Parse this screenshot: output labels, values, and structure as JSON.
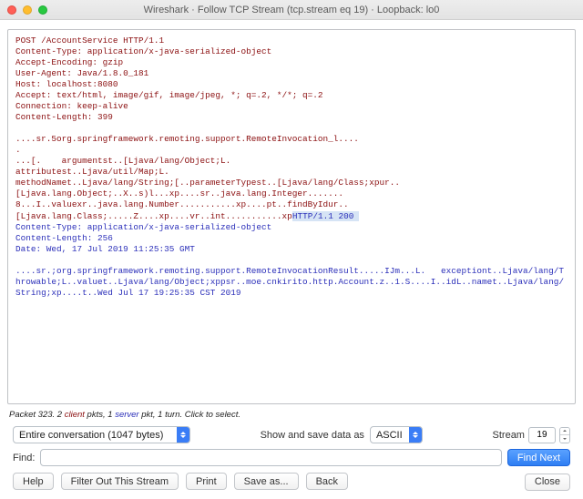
{
  "window": {
    "title": "Wireshark · Follow TCP Stream (tcp.stream eq 19) · Loopback: lo0"
  },
  "stream": {
    "client_block": "POST /AccountService HTTP/1.1\nContent-Type: application/x-java-serialized-object\nAccept-Encoding: gzip\nUser-Agent: Java/1.8.0_181\nHost: localhost:8080\nAccept: text/html, image/gif, image/jpeg, *; q=.2, */*; q=.2\nConnection: keep-alive\nContent-Length: 399\n\n....sr.5org.springframework.remoting.support.RemoteInvocation_l....\n.\n...[.    argumentst..[Ljava/lang/Object;L.\nattributest..Ljava/util/Map;L.\nmethodNamet..Ljava/lang/String;[..parameterTypest..[Ljava/lang/Class;xpur..\n[Ljava.lang.Object;..X..s)l...xp....sr..java.lang.Integer.......\n8...I..valuexr..java.lang.Number...........xp....pt..findByIdur..\n[Ljava.lang.Class;.....Z....xp....vr..int...........xp",
    "server_prefix": "HTTP/1.1 200 ",
    "server_block": "\nContent-Type: application/x-java-serialized-object\nContent-Length: 256\nDate: Wed, 17 Jul 2019 11:25:35 GMT\n\n....sr.;org.springframework.remoting.support.RemoteInvocationResult.....IJm...L.   exceptiont..Ljava/lang/Throwable;L..valuet..Ljava/lang/Object;xppsr..moe.cnkirito.http.Account.z..1.S....I..idL..namet..Ljava/lang/String;xp....t..Wed Jul 17 19:25:35 CST 2019"
  },
  "summary": {
    "p1": "Packet 323. 2 ",
    "client_word": "client",
    "p2": " pkts, 1 ",
    "server_word": "server",
    "p3": " pkt, 1 turn. Click to select."
  },
  "controls": {
    "conversation_label": "Entire conversation (1047 bytes)",
    "show_save_label": "Show and save data as",
    "format_value": "ASCII",
    "stream_label": "Stream",
    "stream_value": "19"
  },
  "findrow": {
    "label": "Find:",
    "placeholder": "",
    "button": "Find Next"
  },
  "buttons": {
    "help": "Help",
    "filter_out": "Filter Out This Stream",
    "print": "Print",
    "save_as": "Save as...",
    "back": "Back",
    "close": "Close"
  }
}
